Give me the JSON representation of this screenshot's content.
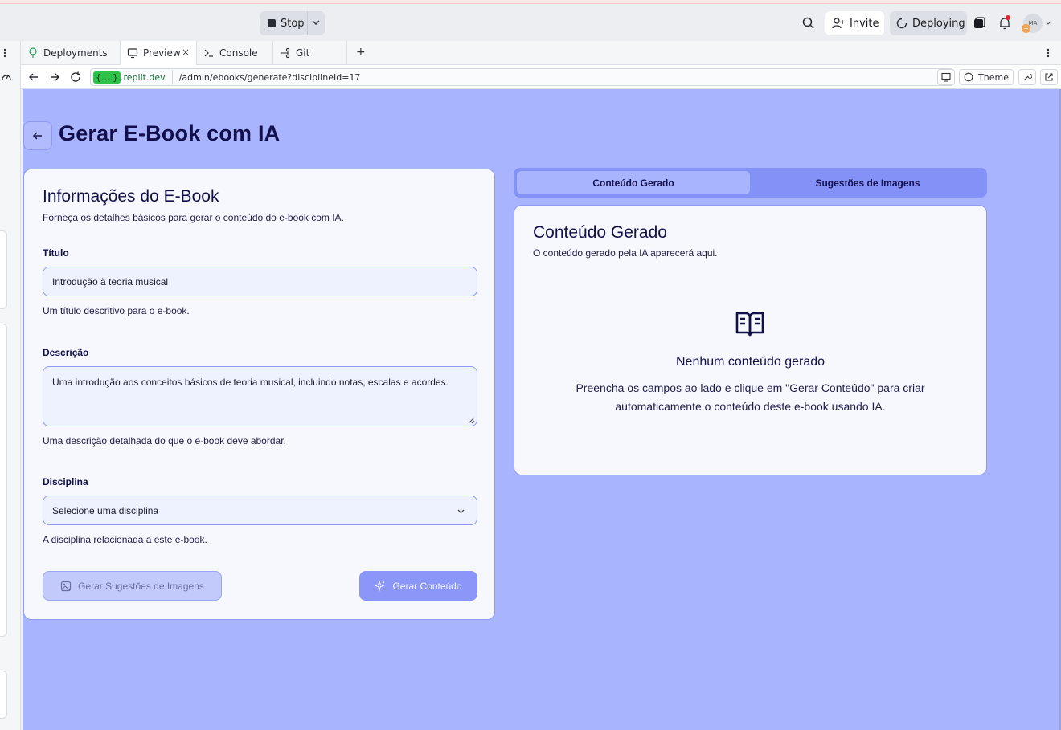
{
  "topbar": {
    "stop_label": "Stop",
    "invite_label": "Invite",
    "deploying_label": "Deploying",
    "avatar_initials": "MA"
  },
  "tabs": [
    {
      "label": "Deployments",
      "icon": "tree-icon"
    },
    {
      "label": "Preview",
      "icon": "monitor-icon",
      "active": true
    },
    {
      "label": "Console",
      "icon": "terminal-icon"
    },
    {
      "label": "Git",
      "icon": "git-icon"
    }
  ],
  "url": {
    "host_highlight": "{....}",
    "host": ".replit.dev",
    "path": "/admin/ebooks/generate?disciplineId=17",
    "theme_label": "Theme"
  },
  "page": {
    "title": "Gerar E-Book com IA"
  },
  "form": {
    "title": "Informações do E-Book",
    "description": "Forneça os detalhes básicos para gerar o conteúdo do e-book com IA.",
    "titulo_label": "Título",
    "titulo_value": "Introdução à teoria musical",
    "titulo_help": "Um título descritivo para o e-book.",
    "descricao_label": "Descrição",
    "descricao_value": "Uma introdução aos conceitos básicos de teoria musical, incluindo notas, escalas e acordes.",
    "descricao_help": "Uma descrição detalhada do que o e-book deve abordar.",
    "disciplina_label": "Disciplina",
    "disciplina_value": "Selecione uma disciplina",
    "disciplina_help": "A disciplina relacionada a este e-book.",
    "btn_images": "Gerar Sugestões de Imagens",
    "btn_generate": "Gerar Conteúdo"
  },
  "result": {
    "tab_content": "Conteúdo Gerado",
    "tab_images": "Sugestões de Imagens",
    "title": "Conteúdo Gerado",
    "description": "O conteúdo gerado pela IA aparecerá aqui.",
    "empty_title": "Nenhum conteúdo gerado",
    "empty_text": "Preencha os campos ao lado e clique em \"Gerar Conteúdo\" para criar automaticamente o conteúdo deste e-book usando IA."
  },
  "colors": {
    "app_background": "#a8b4fd",
    "accent": "#8b97f8",
    "title_text": "#120f4a"
  }
}
